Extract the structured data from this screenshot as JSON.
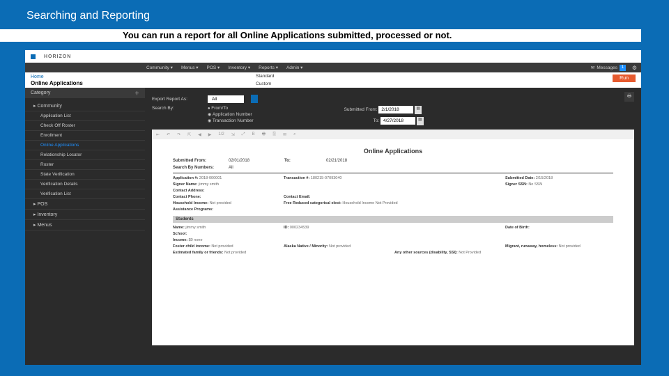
{
  "slide": {
    "title": "Searching and Reporting",
    "subtitle": "You can run a report for all Online Applications submitted, processed or not."
  },
  "brand": "HORIZON",
  "menu": {
    "items": [
      "Community ▾",
      "Menus ▾",
      "POS ▾",
      "Inventory ▾",
      "Reports ▾",
      "Admin ▾"
    ],
    "dropdown": [
      "Standard",
      "Custom"
    ],
    "messages_label": "Messages",
    "messages_count": "1"
  },
  "crumbs": {
    "home": "Home",
    "page": "Online Applications",
    "run": "Run"
  },
  "sidebar": {
    "category": "Category",
    "nodes": [
      {
        "label": "Community",
        "kind": "top"
      },
      {
        "label": "Application List",
        "kind": "sub"
      },
      {
        "label": "Check Off Roster",
        "kind": "sub"
      },
      {
        "label": "Enrollment",
        "kind": "sub"
      },
      {
        "label": "Online Applications",
        "kind": "sub",
        "active": true
      },
      {
        "label": "Relationship Locator",
        "kind": "sub"
      },
      {
        "label": "Roster",
        "kind": "sub"
      },
      {
        "label": "State Verification",
        "kind": "sub"
      },
      {
        "label": "Verification Details",
        "kind": "sub"
      },
      {
        "label": "Verification List",
        "kind": "sub"
      },
      {
        "label": "POS",
        "kind": "top"
      },
      {
        "label": "Inventory",
        "kind": "top"
      },
      {
        "label": "Menus",
        "kind": "top"
      }
    ]
  },
  "filter": {
    "export_label": "Export Report As:",
    "export_value": "All",
    "search_by_label": "Search By:",
    "radios": [
      "From/To",
      "Application Number",
      "Transaction Number"
    ],
    "from_label": "Submitted From:",
    "from_value": "2/1/2018",
    "to_label": "To:",
    "to_value": "4/27/2018"
  },
  "toolbar": [
    "⇤",
    "↶",
    "↷",
    "⇱",
    "◀",
    "▶",
    "1/2",
    "⇲",
    "⤢",
    "B",
    "🖶",
    "🖺",
    "✉",
    "⌕"
  ],
  "report": {
    "title": "Online Applications",
    "submitted_from_lbl": "Submitted From:",
    "submitted_from": "02/01/2018",
    "to_lbl": "To:",
    "to": "02/21/2018",
    "search_lbl": "Search By Numbers:",
    "search": "All",
    "r": {
      "app_no_l": "Application #:",
      "app_no": "2018-000001",
      "trans_no_l": "Transaction #:",
      "trans_no": "180215-07093040",
      "sub_date_l": "Submitted Date:",
      "sub_date": "2/15/2018",
      "signer_nm_l": "Signer Name:",
      "signer_nm": "jimmy smith",
      "signer_ssn_l": "Signer SSN:",
      "signer_ssn": "No SSN",
      "addr_l": "Contact Address:",
      "phone_l": "Contact Phone:",
      "email_l": "Contact Email:",
      "hh_l": "Household Income:",
      "hh": "Not provided",
      "free_l": "Free Reduced categorical elect:",
      "free": "Household Income Not Provided",
      "assist_l": "Assistance Programs:"
    },
    "stu_head": "Students",
    "stu": {
      "name_l": "Name:",
      "name": "jimmy smith",
      "id_l": "ID:",
      "id": "000234539",
      "dob_l": "Date of Birth:",
      "school_l": "School:",
      "income_l": "Income:",
      "income": "$0 none",
      "foster_l": "Foster child income:",
      "foster": "Not provided",
      "native_l": "Alaska Native / Minority:",
      "native": "Not provided",
      "runaway_l": "Migrant, runaway, homeless:",
      "runaway": "Not provided",
      "fam_money_l": "Estimated family or friends:",
      "fam_money": "Not provided",
      "other_l": "Any other sources (disability, SSI):",
      "other": "Not Provided"
    }
  }
}
